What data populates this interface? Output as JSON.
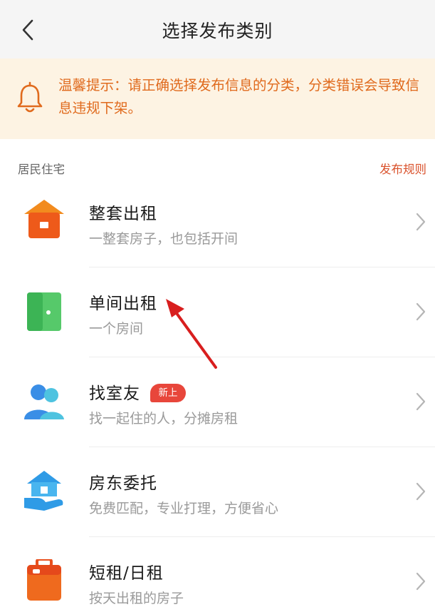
{
  "header": {
    "title": "选择发布类别"
  },
  "notice": {
    "text": "温馨提示：请正确选择发布信息的分类，分类错误会导致信息违规下架。"
  },
  "section": {
    "label": "居民住宅",
    "rule_link": "发布规则"
  },
  "items": [
    {
      "name": "整套出租",
      "desc": "一整套房子，也包括开间",
      "icon": "house-icon"
    },
    {
      "name": "单间出租",
      "desc": "一个房间",
      "icon": "door-icon"
    },
    {
      "name": "找室友",
      "desc": "找一起住的人，分摊房租",
      "icon": "roommates-icon",
      "badge": "新上"
    },
    {
      "name": "房东委托",
      "desc": "免费匹配，专业打理，方便省心",
      "icon": "landlord-hand-icon"
    },
    {
      "name": "短租/日租",
      "desc": "按天出租的房子",
      "icon": "luggage-icon"
    }
  ],
  "colors": {
    "accent": "#d9502a",
    "notice_bg": "#fdf3e3",
    "notice_text": "#e06a1d",
    "badge": "#e8463b"
  }
}
